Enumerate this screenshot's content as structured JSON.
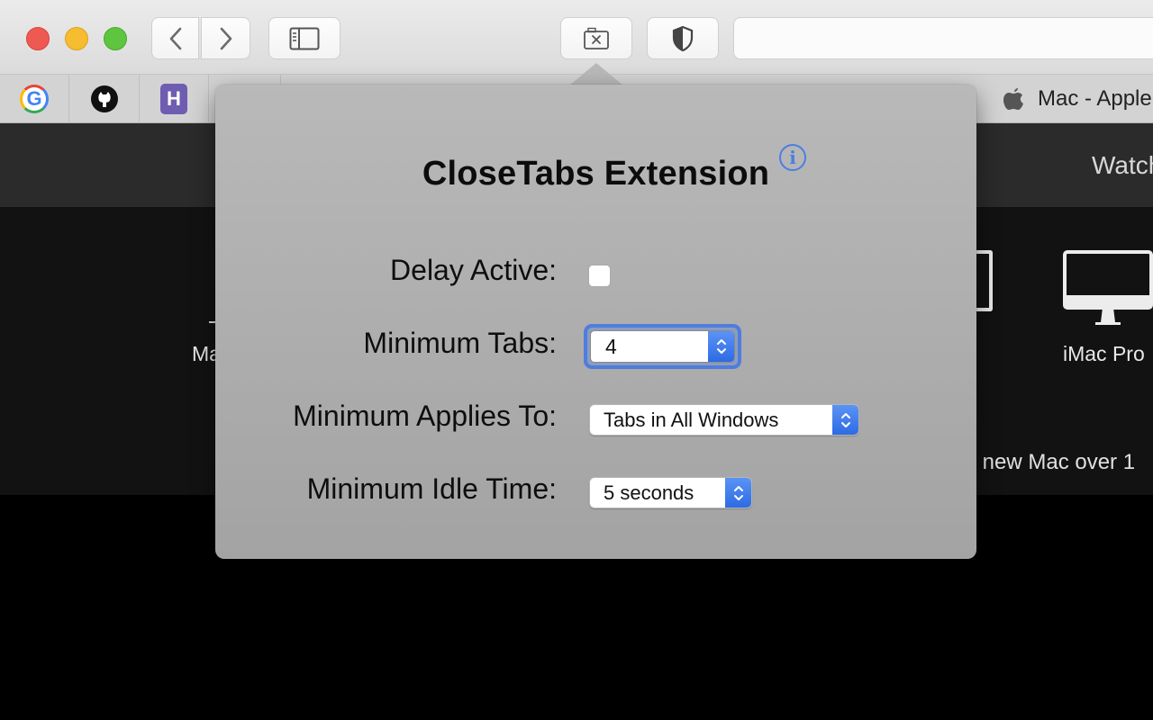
{
  "browser": {
    "favorites": [
      {
        "name": "Google",
        "glyph": "G"
      },
      {
        "name": "GitHub",
        "glyph": ""
      },
      {
        "name": "Heroku",
        "glyph": "H"
      }
    ],
    "right_tab_title": "Mac - Apple"
  },
  "page": {
    "nav_item": "Watch",
    "product_left": "Ma",
    "product_right": "iMac Pro",
    "promo_text": "r new Mac over 1"
  },
  "popover": {
    "title": "CloseTabs Extension",
    "info_glyph": "i",
    "delay_active": {
      "label": "Delay Active:",
      "checked": false
    },
    "minimum_tabs": {
      "label": "Minimum Tabs:",
      "value": "4"
    },
    "minimum_applies_to": {
      "label": "Minimum Applies To:",
      "value": "Tabs in All Windows"
    },
    "minimum_idle_time": {
      "label": "Minimum Idle Time:",
      "value": "5 seconds"
    }
  },
  "colors": {
    "accent": "#2d6be4",
    "focus_ring": "#4f7ddc",
    "traffic_red": "#ee5a52",
    "traffic_yellow": "#f5bd2f",
    "traffic_green": "#5fc53f"
  }
}
